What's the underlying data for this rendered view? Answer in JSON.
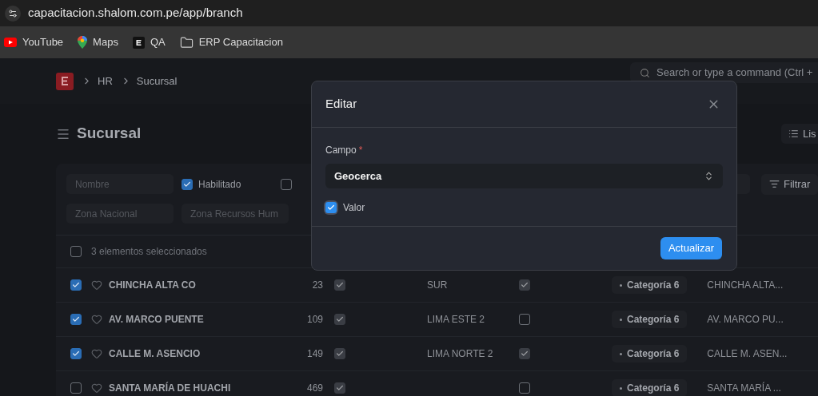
{
  "browser": {
    "url": "capacitacion.shalom.com.pe/app/branch",
    "bookmarks": [
      {
        "label": "YouTube",
        "kind": "youtube"
      },
      {
        "label": "Maps",
        "kind": "maps"
      },
      {
        "label": "QA",
        "kind": "app"
      },
      {
        "label": "ERP Capacitacion",
        "kind": "folder"
      }
    ]
  },
  "navbar": {
    "breadcrumbs": [
      "HR",
      "Sucursal"
    ],
    "search": {
      "placeholder": "Search or type a command (Ctrl + "
    }
  },
  "page": {
    "title": "Sucursal",
    "view_button": "Lis"
  },
  "filters": {
    "row_1": [
      {
        "placeholder": "Nombre"
      }
    ],
    "checkboxes": [
      {
        "label": "Habilitado",
        "checked": true
      },
      {
        "checked": false
      }
    ],
    "row_2": [
      {
        "placeholder": "Zona Nacional"
      },
      {
        "placeholder": "Zona Recursos Hum"
      }
    ],
    "filter_button": "Filtrar"
  },
  "list": {
    "select_all_checked": false,
    "selection_label": "3 elementos seleccionados",
    "rows": [
      {
        "selected": true,
        "name": "CHINCHA ALTA CO",
        "number": "23",
        "flag_1": true,
        "zone": "SUR",
        "flag_2": true,
        "category": "Categoría 6",
        "address": "CHINCHA ALTA..."
      },
      {
        "selected": true,
        "name": "AV. MARCO PUENTE",
        "number": "109",
        "flag_1": true,
        "zone": "LIMA ESTE 2",
        "flag_2": false,
        "category": "Categoría 6",
        "address": "AV. MARCO PU..."
      },
      {
        "selected": true,
        "name": "CALLE M. ASENCIO",
        "number": "149",
        "flag_1": true,
        "zone": "LIMA NORTE 2",
        "flag_2": true,
        "category": "Categoría 6",
        "address": "CALLE M. ASEN..."
      },
      {
        "selected": false,
        "name": "SANTA MARÍA DE HUACHI",
        "number": "469",
        "flag_1": true,
        "flag_2": false,
        "category": "Categoría 6",
        "address": "SANTA MARÍA ..."
      }
    ]
  },
  "dialog": {
    "title": "Editar",
    "field_label": "Campo",
    "required_mark": "*",
    "select_value": "Geocerca",
    "checkbox": {
      "label": "Valor",
      "checked": true
    },
    "submit": "Actualizar"
  }
}
